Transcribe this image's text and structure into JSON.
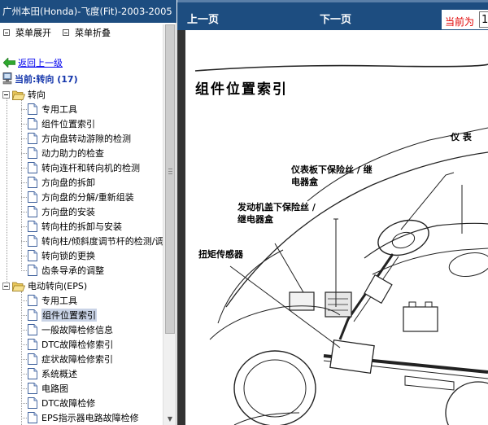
{
  "window": {
    "title": "广州本田(Honda)-飞度(Fit)-2003-2005"
  },
  "menu": {
    "expand_label": "菜单展开",
    "collapse_label": "菜单折叠"
  },
  "back": {
    "label": "返回上一级"
  },
  "current": {
    "label": "当前:转向 (17)"
  },
  "tree": {
    "folder1": {
      "label": "转向",
      "items": [
        "专用工具",
        "组件位置索引",
        "方向盘转动游隙的检测",
        "动力助力的检查",
        "转向连杆和转向机的检测",
        "方向盘的拆卸",
        "方向盘的分解/重新组装",
        "方向盘的安装",
        "转向柱的拆卸与安装",
        "转向柱/倾斜度调节杆的检测/调整",
        "转向锁的更换",
        "齿条导承的调整"
      ]
    },
    "folder2": {
      "label": "电动转向(EPS)",
      "items": [
        "专用工具",
        "组件位置索引",
        "一般故障检修信息",
        "DTC故障检修索引",
        "症状故障检修索引",
        "系统概述",
        "电路图",
        "DTC故障检修",
        "EPS指示器电路故障检修"
      ],
      "selected_index": 1
    }
  },
  "nav": {
    "prev_label": "上一页",
    "next_label": "下一页",
    "current_page_label": "当前为",
    "current_page_value": "1"
  },
  "diagram": {
    "title": "组件位置索引",
    "callouts": {
      "instrument": "仪 表",
      "dash_fuse": "仪表板下保险丝 / 继\n电器盒",
      "hood_fuse": "发动机盖下保险丝 /\n继电器盒",
      "torque_sensor": "扭矩传感器"
    }
  },
  "colors": {
    "title_bar": "#1d4d80",
    "link": "#0000ee",
    "current_label": "#1133aa",
    "page_label": "#e00000",
    "selected_bg": "#c9d3e6"
  }
}
